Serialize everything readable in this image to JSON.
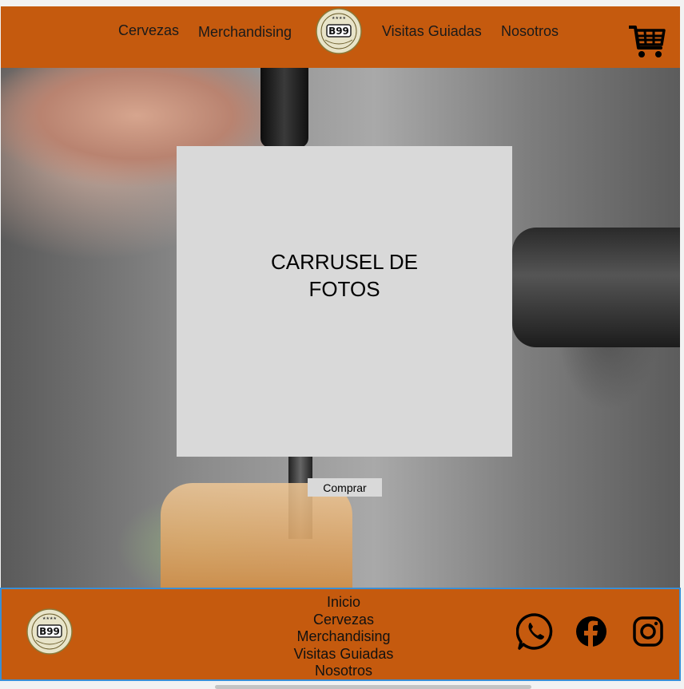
{
  "header": {
    "nav": [
      {
        "label": "Cervezas"
      },
      {
        "label": "Merchandising"
      },
      {
        "label": "Visitas Guiadas"
      },
      {
        "label": "Nosotros"
      }
    ],
    "logo_text": "B99",
    "cart_icon": "cart-icon"
  },
  "hero": {
    "carousel_text": "CARRUSEL DE FOTOS",
    "buy_label": "Comprar"
  },
  "footer": {
    "logo_text": "B99",
    "links": [
      "Inicio",
      "Cervezas",
      "Merchandising",
      "Visitas Guiadas",
      "Nosotros"
    ],
    "social": [
      "whatsapp-icon",
      "facebook-icon",
      "instagram-icon"
    ]
  },
  "colors": {
    "brand_orange": "#c55a0e",
    "carousel_bg": "#d9d9d9",
    "footer_border": "#3a8fd6"
  }
}
